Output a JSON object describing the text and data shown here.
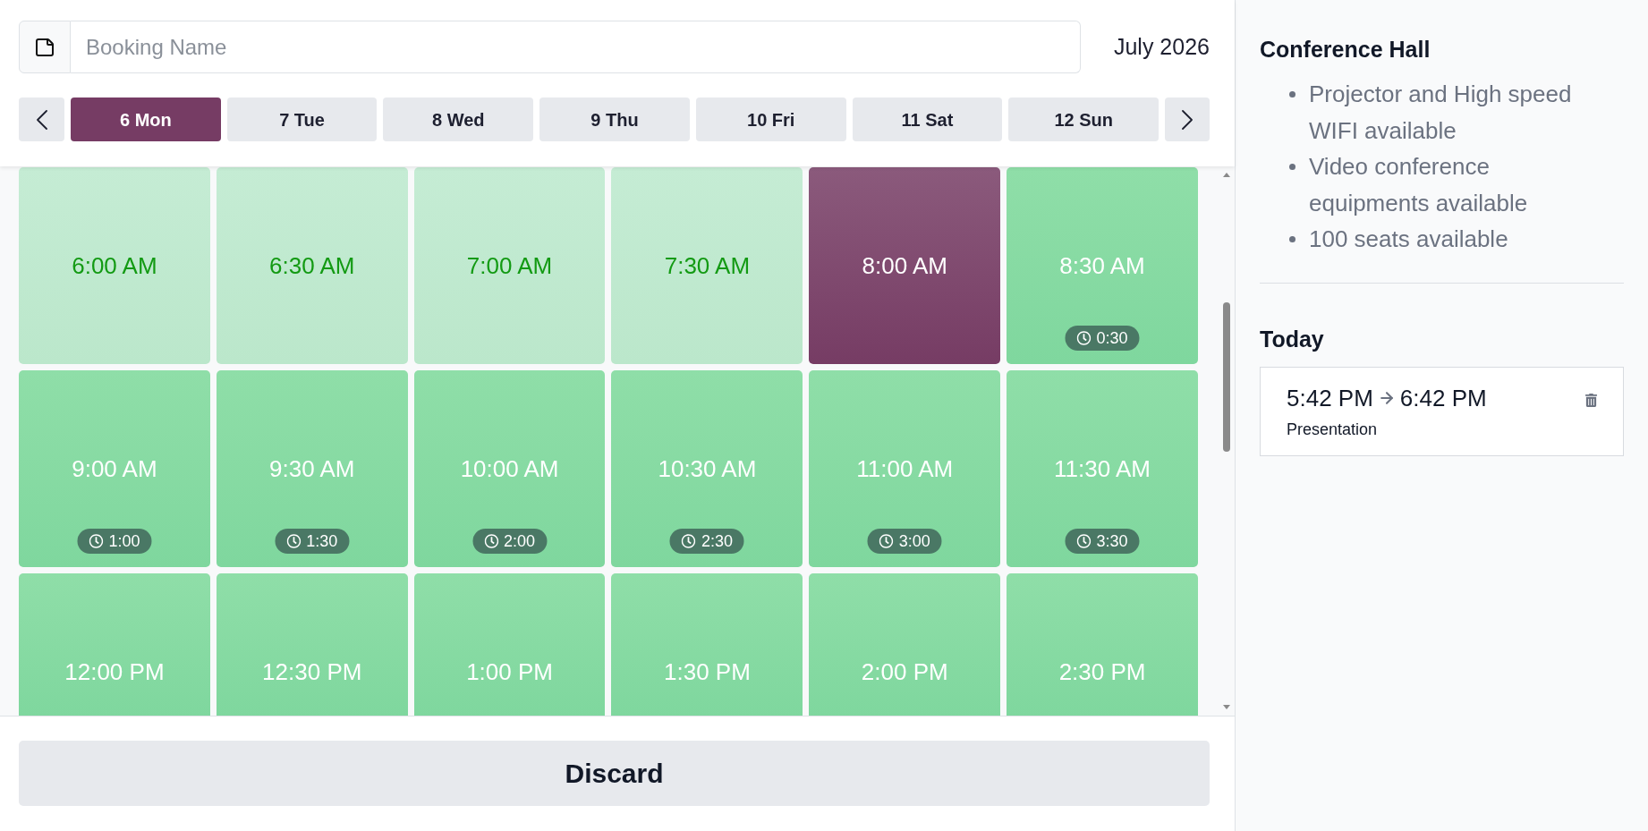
{
  "booking_name_field": {
    "placeholder": "Booking Name"
  },
  "month_label": "July 2026",
  "days": [
    {
      "label": "6 Mon",
      "selected": true
    },
    {
      "label": "7 Tue",
      "selected": false
    },
    {
      "label": "8 Wed",
      "selected": false
    },
    {
      "label": "9 Thu",
      "selected": false
    },
    {
      "label": "10 Fri",
      "selected": false
    },
    {
      "label": "11 Sat",
      "selected": false
    },
    {
      "label": "12 Sun",
      "selected": false
    }
  ],
  "time_slots": [
    {
      "time": "6:00 AM",
      "dimmed": true,
      "selected": false
    },
    {
      "time": "6:30 AM",
      "dimmed": true,
      "selected": false
    },
    {
      "time": "7:00 AM",
      "dimmed": true,
      "selected": false
    },
    {
      "time": "7:30 AM",
      "dimmed": true,
      "selected": false
    },
    {
      "time": "8:00 AM",
      "dimmed": false,
      "selected": true
    },
    {
      "time": "8:30 AM",
      "dimmed": false,
      "selected": false,
      "duration": "0:30"
    },
    {
      "time": "9:00 AM",
      "dimmed": false,
      "selected": false,
      "duration": "1:00"
    },
    {
      "time": "9:30 AM",
      "dimmed": false,
      "selected": false,
      "duration": "1:30"
    },
    {
      "time": "10:00 AM",
      "dimmed": false,
      "selected": false,
      "duration": "2:00"
    },
    {
      "time": "10:30 AM",
      "dimmed": false,
      "selected": false,
      "duration": "2:30"
    },
    {
      "time": "11:00 AM",
      "dimmed": false,
      "selected": false,
      "duration": "3:00"
    },
    {
      "time": "11:30 AM",
      "dimmed": false,
      "selected": false,
      "duration": "3:30"
    },
    {
      "time": "12:00 PM",
      "dimmed": false,
      "selected": false
    },
    {
      "time": "12:30 PM",
      "dimmed": false,
      "selected": false
    },
    {
      "time": "1:00 PM",
      "dimmed": false,
      "selected": false
    },
    {
      "time": "1:30 PM",
      "dimmed": false,
      "selected": false
    },
    {
      "time": "2:00 PM",
      "dimmed": false,
      "selected": false
    },
    {
      "time": "2:30 PM",
      "dimmed": false,
      "selected": false
    }
  ],
  "discard_button": {
    "label": "Discard"
  },
  "room": {
    "name": "Conference Hall",
    "features": [
      "Projector and High speed WIFI available",
      "Video conference equipments available",
      "100 seats available"
    ]
  },
  "today": {
    "title": "Today",
    "bookings": [
      {
        "start": "5:42 PM",
        "end": "6:42 PM",
        "name": "Presentation"
      }
    ]
  }
}
